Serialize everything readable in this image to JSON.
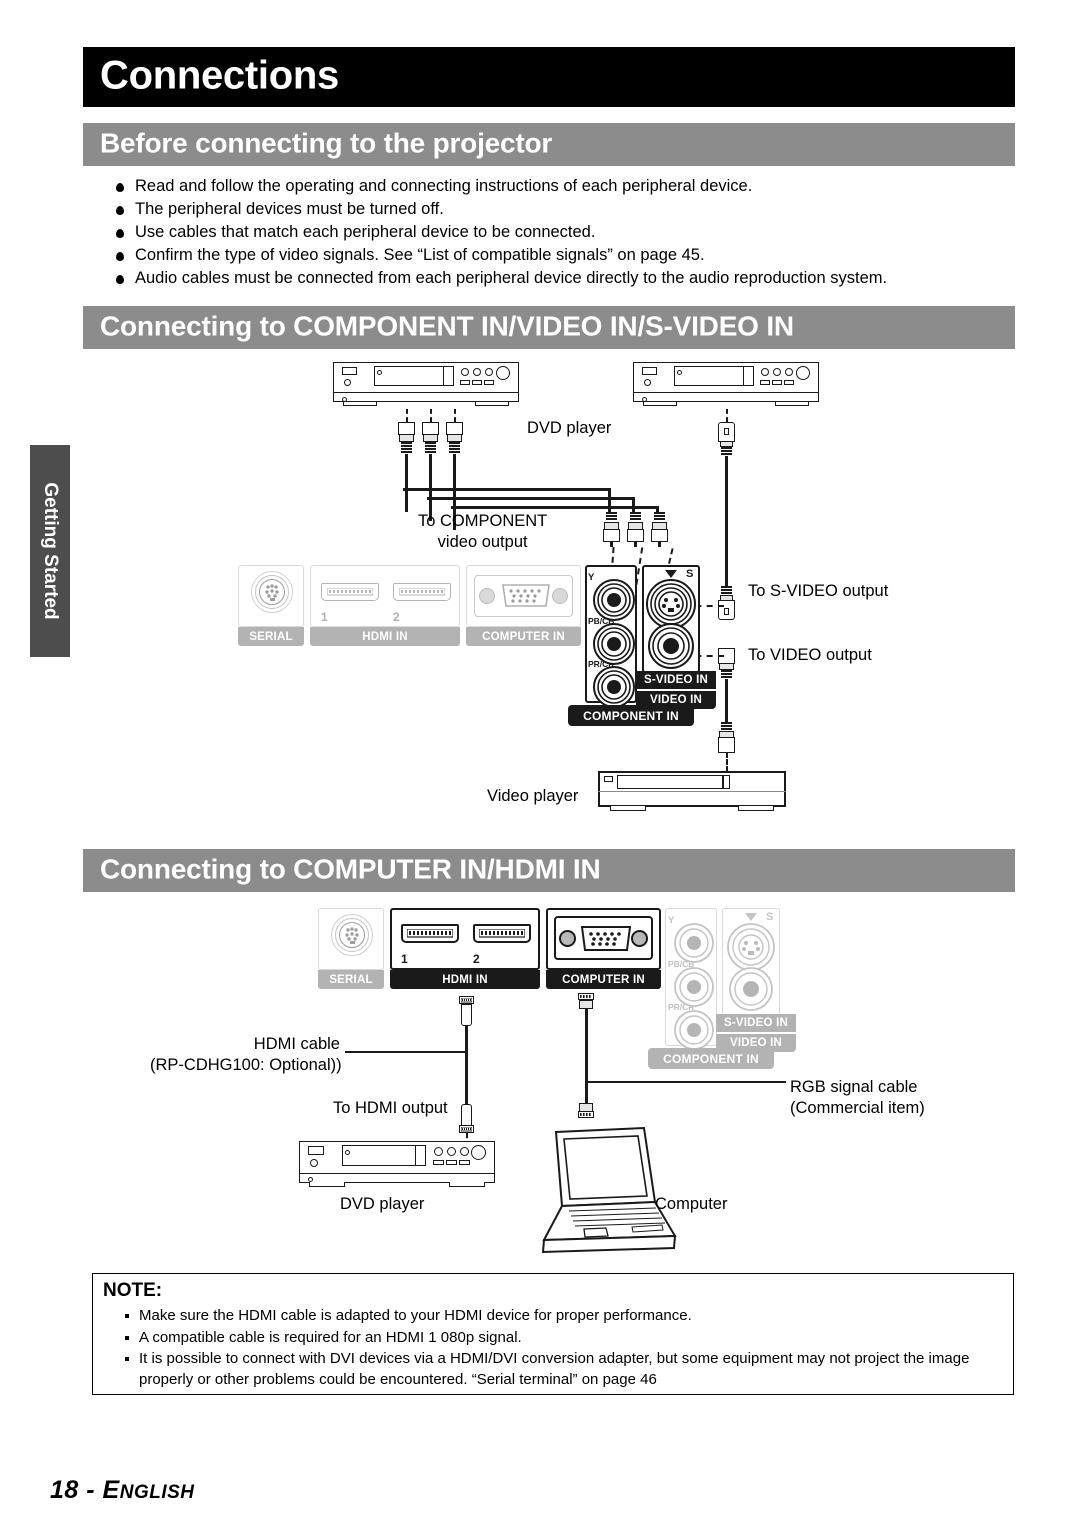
{
  "chapter": {
    "title": "Connections"
  },
  "side_tab": {
    "label": "Getting Started"
  },
  "sections": [
    {
      "title": "Before connecting to the projector"
    },
    {
      "title": "Connecting to COMPONENT IN/VIDEO IN/S-VIDEO IN"
    },
    {
      "title": "Connecting to COMPUTER IN/HDMI IN"
    }
  ],
  "intro_bullets": [
    "Read and follow the operating and connecting instructions of each peripheral device.",
    "The peripheral devices must be turned off.",
    "Use cables that match each peripheral device to be connected.",
    "Confirm the type of video signals. See “List of compatible signals” on page 45.",
    "Audio cables must be connected from each peripheral device directly to the audio reproduction system."
  ],
  "diagram1": {
    "labels": {
      "dvd_player": "DVD player",
      "to_component_line1": "To COMPONENT",
      "to_component_line2": "video output",
      "to_svideo": "To S-VIDEO output",
      "to_video": "To VIDEO output",
      "video_player": "Video player"
    },
    "panel": {
      "serial": "SERIAL",
      "hdmi_in": "HDMI IN",
      "hdmi_1": "1",
      "hdmi_2": "2",
      "computer_in": "COMPUTER IN",
      "component_in": "COMPONENT IN",
      "svideo_in": "S-VIDEO IN",
      "video_in": "VIDEO IN",
      "y": "Y",
      "pb_cb": "PB/CB",
      "pr_cr": "PR/CR",
      "s_mark": "S"
    }
  },
  "diagram2": {
    "labels": {
      "hdmi_cable_line1": "HDMI cable",
      "hdmi_cable_line2": "(RP-CDHG100: Optional))",
      "to_hdmi_output": "To HDMI output",
      "rgb_cable_line1": "RGB signal cable",
      "rgb_cable_line2": "(Commercial item)",
      "dvd_player": "DVD player",
      "computer": "Computer"
    },
    "panel": {
      "serial": "SERIAL",
      "hdmi_in": "HDMI IN",
      "hdmi_1": "1",
      "hdmi_2": "2",
      "computer_in": "COMPUTER IN",
      "component_in": "COMPONENT IN",
      "svideo_in": "S-VIDEO IN",
      "video_in": "VIDEO IN",
      "y": "Y",
      "pb_cb": "PB/CB",
      "pr_cr": "PR/CR",
      "s_mark": "S"
    }
  },
  "note": {
    "title": "NOTE:",
    "items": [
      "Make sure the HDMI cable is adapted to your HDMI device for proper performance.",
      "A compatible cable is required for an HDMI 1 080p signal.",
      "It is possible to connect with DVI devices via a HDMI/DVI conversion adapter, but some equipment may not project the image properly or other problems could be encountered. “Serial terminal” on page 46"
    ]
  },
  "footer": {
    "page": "18",
    "sep": " - ",
    "lang_first": "E",
    "lang_rest": "NGLISH"
  },
  "colors": {
    "chapter_bar": "#000000",
    "section_bar": "#8c8c8c",
    "side_tab": "#4d4d4d",
    "label_active": "#1a1a1a",
    "label_inactive": "#b3b3b3"
  }
}
